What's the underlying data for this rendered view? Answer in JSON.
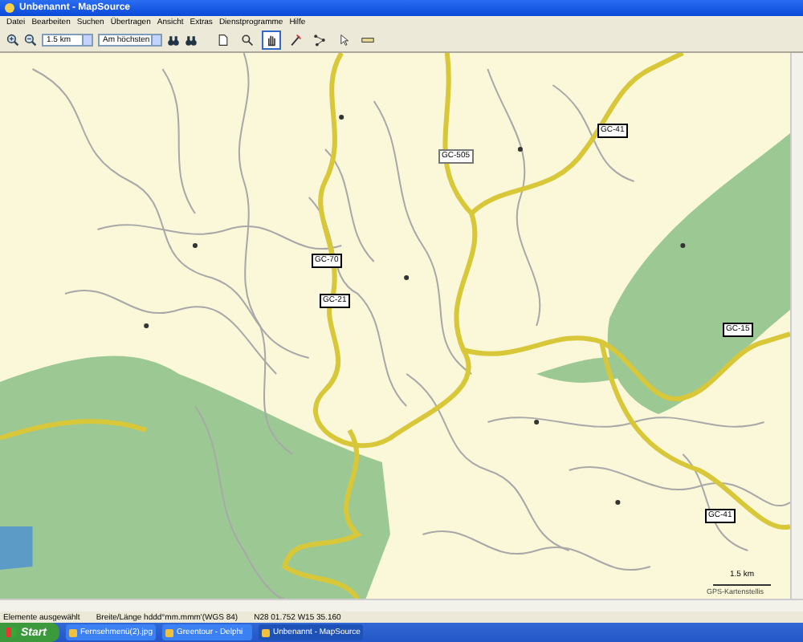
{
  "window": {
    "title": "Unbenannt - MapSource"
  },
  "menu": [
    "Datei",
    "Bearbeiten",
    "Suchen",
    "Übertragen",
    "Ansicht",
    "Extras",
    "Dienstprogramme",
    "Hilfe"
  ],
  "toolbar": {
    "scale_dropdown": "1.5 km",
    "detail_dropdown": "Am höchsten",
    "tools": [
      {
        "kind": "page",
        "selected": false
      },
      {
        "kind": "zoom",
        "selected": false
      },
      {
        "kind": "hand",
        "selected": true
      },
      {
        "kind": "pen",
        "selected": false
      },
      {
        "kind": "route",
        "selected": false
      },
      {
        "kind": "pointer",
        "selected": false
      },
      {
        "kind": "ruler",
        "selected": false
      }
    ]
  },
  "map": {
    "road_labels": [
      "GC-505",
      "GC-41",
      "GC-70",
      "GC-21",
      "GC-15",
      "GC-41"
    ],
    "scale": "1.5 km",
    "credit": "GPS-Kartenstellis"
  },
  "status_bar": [
    "Elemente ausgewählt",
    "Breite/Länge hddd°mm.mmm'(WGS 84)",
    "N28 01.752 W15 35.160"
  ],
  "taskbar": {
    "start": "Start",
    "items": [
      {
        "label": "Fernsehmenü(2).jpg",
        "selected": false
      },
      {
        "label": "Greentour - Delphi",
        "selected": false
      },
      {
        "label": "Unbenannt - MapSource",
        "selected": true
      }
    ]
  }
}
